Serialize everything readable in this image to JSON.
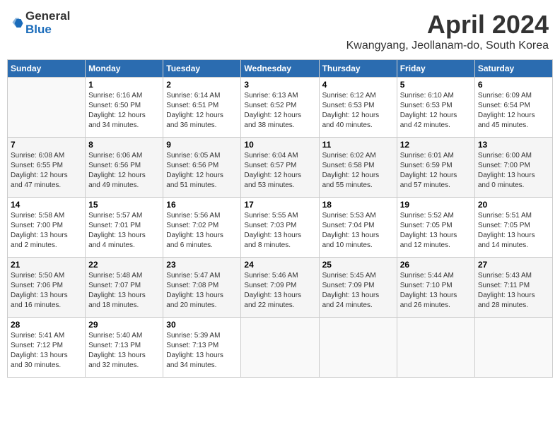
{
  "header": {
    "logo_general": "General",
    "logo_blue": "Blue",
    "month_title": "April 2024",
    "location": "Kwangyang, Jeollanam-do, South Korea"
  },
  "weekdays": [
    "Sunday",
    "Monday",
    "Tuesday",
    "Wednesday",
    "Thursday",
    "Friday",
    "Saturday"
  ],
  "weeks": [
    [
      {
        "day": "",
        "info": ""
      },
      {
        "day": "1",
        "info": "Sunrise: 6:16 AM\nSunset: 6:50 PM\nDaylight: 12 hours\nand 34 minutes."
      },
      {
        "day": "2",
        "info": "Sunrise: 6:14 AM\nSunset: 6:51 PM\nDaylight: 12 hours\nand 36 minutes."
      },
      {
        "day": "3",
        "info": "Sunrise: 6:13 AM\nSunset: 6:52 PM\nDaylight: 12 hours\nand 38 minutes."
      },
      {
        "day": "4",
        "info": "Sunrise: 6:12 AM\nSunset: 6:53 PM\nDaylight: 12 hours\nand 40 minutes."
      },
      {
        "day": "5",
        "info": "Sunrise: 6:10 AM\nSunset: 6:53 PM\nDaylight: 12 hours\nand 42 minutes."
      },
      {
        "day": "6",
        "info": "Sunrise: 6:09 AM\nSunset: 6:54 PM\nDaylight: 12 hours\nand 45 minutes."
      }
    ],
    [
      {
        "day": "7",
        "info": "Sunrise: 6:08 AM\nSunset: 6:55 PM\nDaylight: 12 hours\nand 47 minutes."
      },
      {
        "day": "8",
        "info": "Sunrise: 6:06 AM\nSunset: 6:56 PM\nDaylight: 12 hours\nand 49 minutes."
      },
      {
        "day": "9",
        "info": "Sunrise: 6:05 AM\nSunset: 6:56 PM\nDaylight: 12 hours\nand 51 minutes."
      },
      {
        "day": "10",
        "info": "Sunrise: 6:04 AM\nSunset: 6:57 PM\nDaylight: 12 hours\nand 53 minutes."
      },
      {
        "day": "11",
        "info": "Sunrise: 6:02 AM\nSunset: 6:58 PM\nDaylight: 12 hours\nand 55 minutes."
      },
      {
        "day": "12",
        "info": "Sunrise: 6:01 AM\nSunset: 6:59 PM\nDaylight: 12 hours\nand 57 minutes."
      },
      {
        "day": "13",
        "info": "Sunrise: 6:00 AM\nSunset: 7:00 PM\nDaylight: 13 hours\nand 0 minutes."
      }
    ],
    [
      {
        "day": "14",
        "info": "Sunrise: 5:58 AM\nSunset: 7:00 PM\nDaylight: 13 hours\nand 2 minutes."
      },
      {
        "day": "15",
        "info": "Sunrise: 5:57 AM\nSunset: 7:01 PM\nDaylight: 13 hours\nand 4 minutes."
      },
      {
        "day": "16",
        "info": "Sunrise: 5:56 AM\nSunset: 7:02 PM\nDaylight: 13 hours\nand 6 minutes."
      },
      {
        "day": "17",
        "info": "Sunrise: 5:55 AM\nSunset: 7:03 PM\nDaylight: 13 hours\nand 8 minutes."
      },
      {
        "day": "18",
        "info": "Sunrise: 5:53 AM\nSunset: 7:04 PM\nDaylight: 13 hours\nand 10 minutes."
      },
      {
        "day": "19",
        "info": "Sunrise: 5:52 AM\nSunset: 7:05 PM\nDaylight: 13 hours\nand 12 minutes."
      },
      {
        "day": "20",
        "info": "Sunrise: 5:51 AM\nSunset: 7:05 PM\nDaylight: 13 hours\nand 14 minutes."
      }
    ],
    [
      {
        "day": "21",
        "info": "Sunrise: 5:50 AM\nSunset: 7:06 PM\nDaylight: 13 hours\nand 16 minutes."
      },
      {
        "day": "22",
        "info": "Sunrise: 5:48 AM\nSunset: 7:07 PM\nDaylight: 13 hours\nand 18 minutes."
      },
      {
        "day": "23",
        "info": "Sunrise: 5:47 AM\nSunset: 7:08 PM\nDaylight: 13 hours\nand 20 minutes."
      },
      {
        "day": "24",
        "info": "Sunrise: 5:46 AM\nSunset: 7:09 PM\nDaylight: 13 hours\nand 22 minutes."
      },
      {
        "day": "25",
        "info": "Sunrise: 5:45 AM\nSunset: 7:09 PM\nDaylight: 13 hours\nand 24 minutes."
      },
      {
        "day": "26",
        "info": "Sunrise: 5:44 AM\nSunset: 7:10 PM\nDaylight: 13 hours\nand 26 minutes."
      },
      {
        "day": "27",
        "info": "Sunrise: 5:43 AM\nSunset: 7:11 PM\nDaylight: 13 hours\nand 28 minutes."
      }
    ],
    [
      {
        "day": "28",
        "info": "Sunrise: 5:41 AM\nSunset: 7:12 PM\nDaylight: 13 hours\nand 30 minutes."
      },
      {
        "day": "29",
        "info": "Sunrise: 5:40 AM\nSunset: 7:13 PM\nDaylight: 13 hours\nand 32 minutes."
      },
      {
        "day": "30",
        "info": "Sunrise: 5:39 AM\nSunset: 7:13 PM\nDaylight: 13 hours\nand 34 minutes."
      },
      {
        "day": "",
        "info": ""
      },
      {
        "day": "",
        "info": ""
      },
      {
        "day": "",
        "info": ""
      },
      {
        "day": "",
        "info": ""
      }
    ]
  ]
}
